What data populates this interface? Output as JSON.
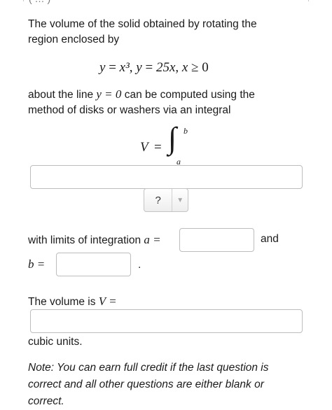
{
  "header_fragment": "( … )",
  "intro": "The volume of the solid obtained by rotating the region enclosed by",
  "equation": {
    "y1": "y",
    "eq1": "=",
    "rhs1": "x³",
    "sep1": ",",
    "y2": "y",
    "eq2": "=",
    "rhs2": "25x",
    "sep2": ",",
    "x": "x",
    "geq": "≥",
    "zero": "0"
  },
  "about_line": {
    "prefix": "about the line",
    "math": "y = 0",
    "suffix": "can be computed using the",
    "line2": "method of disks or washers via an integral"
  },
  "integral": {
    "V": "V",
    "eq": "=",
    "sign": "∫",
    "upper": "b",
    "lower": "a"
  },
  "integrand_input": {
    "value": "",
    "placeholder": ""
  },
  "select": {
    "value": "?",
    "arrow": "▼"
  },
  "limits": {
    "text": "with limits of integration",
    "a_math": "a =",
    "and": "and",
    "b_math": "b =",
    "period": ".",
    "a_value": "",
    "b_value": ""
  },
  "volume": {
    "text": "The volume is",
    "math": "V =",
    "value": "",
    "units": "cubic units."
  },
  "note": "Note: You can earn full credit if the last question is correct and all other questions are either blank or correct."
}
